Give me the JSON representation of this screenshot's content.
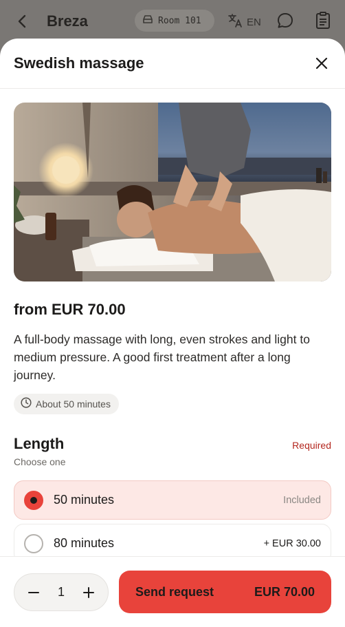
{
  "topbar": {
    "hotel_name": "Breza",
    "room": "Room 101",
    "language": "EN"
  },
  "sheet": {
    "title": "Swedish massage",
    "price": "from EUR 70.00",
    "description": "A full-body massage with long, even strokes and light to medium pressure. A good first treatment after a long journey.",
    "duration": "About 50 minutes"
  },
  "length": {
    "title": "Length",
    "subtitle": "Choose one",
    "required": "Required",
    "options": [
      {
        "label": "50 minutes",
        "extra": "Included",
        "selected": true
      },
      {
        "label": "80 minutes",
        "extra": "+ EUR 30.00",
        "selected": false
      }
    ]
  },
  "footer": {
    "quantity": "1",
    "send_label": "Send request",
    "total": "EUR 70.00"
  },
  "colors": {
    "accent": "#e8433b",
    "selected_bg": "#fde8e5",
    "required": "#b3261e"
  },
  "icons": [
    "back-icon",
    "car-icon",
    "translate-icon",
    "chat-icon",
    "document-icon",
    "close-icon",
    "clock-icon",
    "minus-icon",
    "plus-icon"
  ]
}
